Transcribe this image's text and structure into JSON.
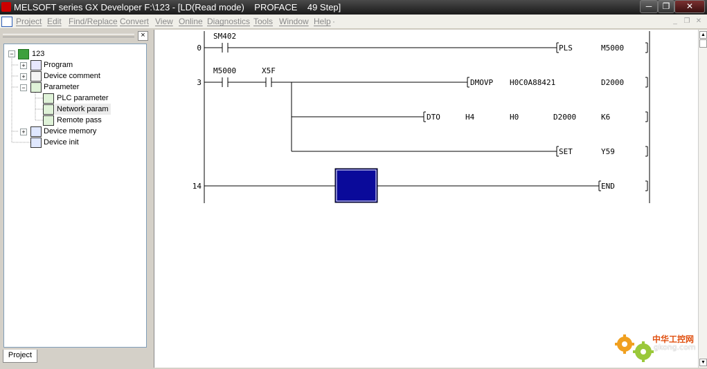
{
  "window": {
    "title": "MELSOFT series GX Developer F:\\123 - [LD(Read mode)    PROFACE    49 Step]",
    "minimize": "─",
    "restore": "❐",
    "close": "✕"
  },
  "menu": [
    "Project",
    "Edit",
    "Find/Replace",
    "Convert",
    "View",
    "Online",
    "Diagnostics",
    "Tools",
    "Window",
    "Help"
  ],
  "menu_extra": "·",
  "panel": {
    "close": "×",
    "tab": "Project"
  },
  "tree": {
    "root": "123",
    "items": [
      {
        "label": "Program",
        "expander": "+"
      },
      {
        "label": "Device comment",
        "expander": "+"
      },
      {
        "label": "Parameter",
        "expander": "−"
      },
      {
        "label": "PLC parameter",
        "expander": ""
      },
      {
        "label": "Network param",
        "expander": ""
      },
      {
        "label": "Remote pass",
        "expander": ""
      },
      {
        "label": "Device memory",
        "expander": "+"
      },
      {
        "label": "Device init",
        "expander": ""
      }
    ]
  },
  "ladder": {
    "steps": [
      "0",
      "3",
      "14"
    ],
    "contacts": [
      "SM402",
      "M5000",
      "X5F"
    ],
    "instructions": [
      {
        "mnemonic": "PLS",
        "operands": [
          "M5000"
        ]
      },
      {
        "mnemonic": "DMOVP",
        "operands": [
          "H0C0A88421",
          "D2000"
        ]
      },
      {
        "mnemonic": "DTO",
        "operands": [
          "H4",
          "H0",
          "D2000",
          "K6"
        ]
      },
      {
        "mnemonic": "SET",
        "operands": [
          "Y59"
        ]
      },
      {
        "mnemonic": "END",
        "operands": []
      }
    ],
    "cursor_color": "#0a0a9a"
  },
  "watermark": {
    "line1": "中华工控网",
    "line2": "gkong.com"
  }
}
